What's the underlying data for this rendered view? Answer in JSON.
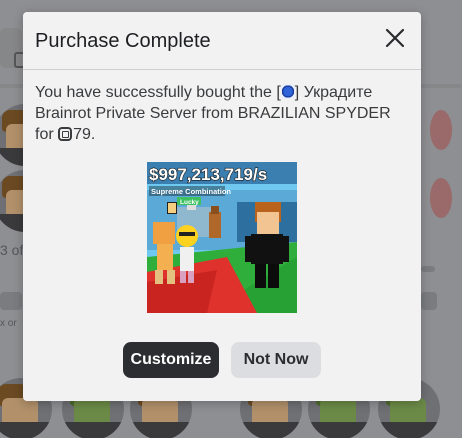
{
  "background": {
    "partial_text": "3 of",
    "partial_text_2": "x or"
  },
  "modal": {
    "title": "Purchase Complete",
    "message_prefix": "You have successfully bought the [",
    "message_item_suffix": "] Украдите Brainrot Private Server from BRAZILIAN SPYDER for",
    "price": "79",
    "message_end": ".",
    "thumbnail": {
      "banner_text": "$997,213,719/s",
      "tag_text": "Supreme Combination",
      "tag_sub": "Lucky"
    },
    "buttons": {
      "customize": "Customize",
      "not_now": "Not Now"
    }
  },
  "icons": {
    "close": "close-icon",
    "robux": "robux-icon",
    "item": "private-server-icon"
  },
  "colors": {
    "primary_button": "#2c2d31",
    "secondary_button": "#dcdde0",
    "modal_bg": "#f2f2f3",
    "overlay": "#8e8f92"
  }
}
